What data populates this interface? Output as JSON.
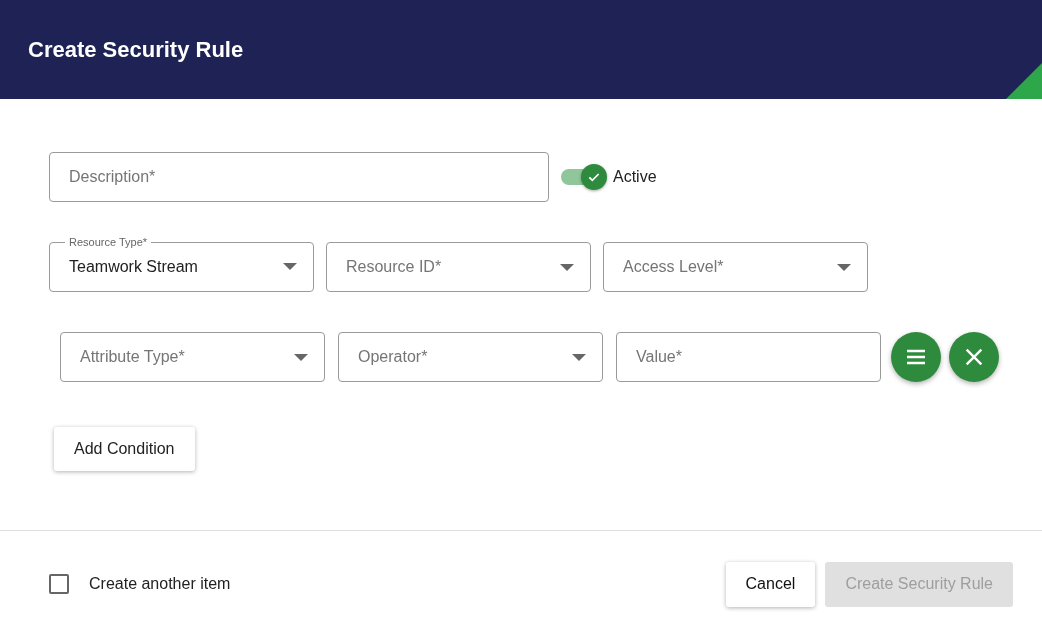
{
  "dialog": {
    "title": "Create Security Rule"
  },
  "description": {
    "placeholder": "Description*"
  },
  "active": {
    "label": "Active",
    "on": true
  },
  "resource_fields": [
    {
      "kind": "select",
      "label": "Resource Type*",
      "value": "Teamwork Stream"
    },
    {
      "kind": "select",
      "placeholder": "Resource ID*"
    },
    {
      "kind": "select",
      "placeholder": "Access Level*"
    }
  ],
  "conditions": [
    {
      "fields": [
        {
          "kind": "select",
          "placeholder": "Attribute Type*"
        },
        {
          "kind": "select",
          "placeholder": "Operator*"
        },
        {
          "kind": "text",
          "placeholder": "Value*"
        }
      ]
    }
  ],
  "add_condition_button": "Add Condition",
  "create_another": {
    "label": "Create another item",
    "checked": false
  },
  "buttons": [
    {
      "label": "Cancel",
      "disabled": false
    },
    {
      "label": "Create Security Rule",
      "disabled": true
    }
  ]
}
